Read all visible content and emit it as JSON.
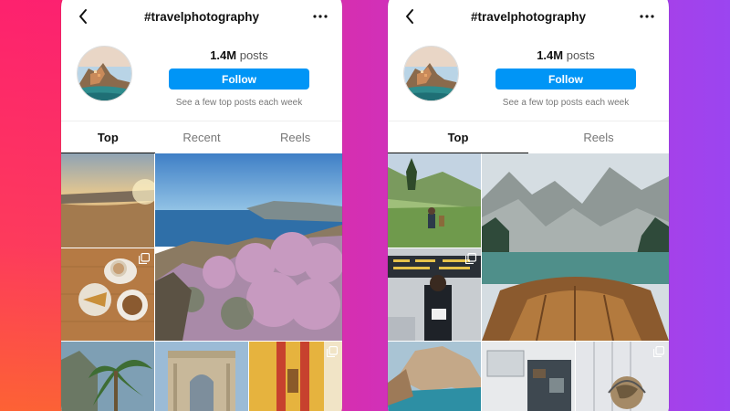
{
  "left_screen": {
    "nav": {
      "title": "#travelphotography"
    },
    "profile": {
      "posts_count": "1.4M",
      "posts_label": "posts",
      "follow_label": "Follow",
      "note": "See a few top posts each week"
    },
    "tabs": [
      {
        "label": "Top",
        "active": true
      },
      {
        "label": "Recent",
        "active": false
      },
      {
        "label": "Reels",
        "active": false
      }
    ]
  },
  "right_screen": {
    "nav": {
      "title": "#travelphotography"
    },
    "profile": {
      "posts_count": "1.4M",
      "posts_label": "posts",
      "follow_label": "Follow",
      "note": "See a few top posts each week"
    },
    "tabs": [
      {
        "label": "Top",
        "active": true
      },
      {
        "label": "Reels",
        "active": false
      }
    ]
  },
  "colors": {
    "follow_button": "#0095f6",
    "background_gradient_start": "#f2346e",
    "background_gradient_end": "#9b45f0"
  }
}
